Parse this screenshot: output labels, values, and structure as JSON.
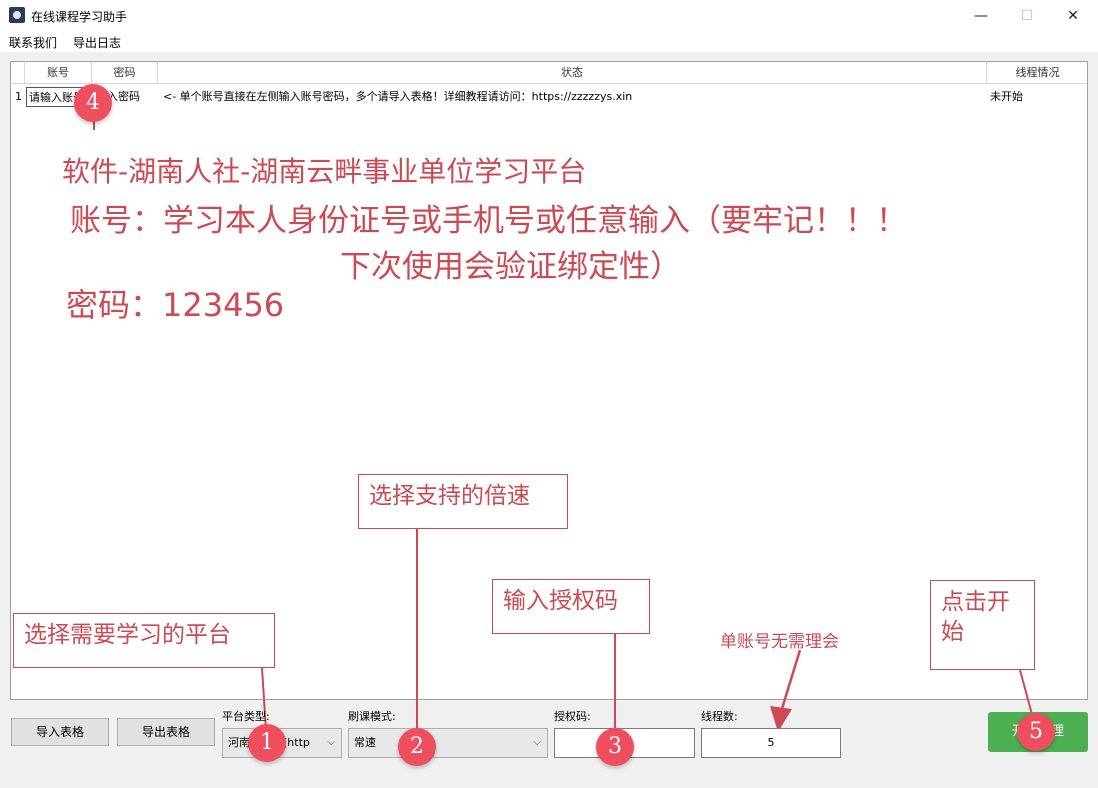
{
  "window": {
    "title": "在线课程学习助手",
    "min_symbol": "—",
    "max_symbol": "☐",
    "close_symbol": "✕"
  },
  "menu": {
    "items": [
      "联系我们",
      "导出日志"
    ]
  },
  "table": {
    "headers": [
      "账号",
      "密码",
      "状态",
      "线程情况"
    ],
    "rows": [
      {
        "index": "1",
        "account": "请输入账号",
        "password": "输入密码",
        "status": "<- 单个账号直接在左侧输入账号密码，多个请导入表格！详细教程请访问：https://zzzzzys.xin",
        "thread": "未开始"
      }
    ]
  },
  "overlay": {
    "line1": "软件-湖南人社-湖南云畔事业单位学习平台",
    "line2": "账号：学习本人身份证号或手机号或任意输入（要牢记！！！",
    "line3": "下次使用会验证绑定性）",
    "line4": "密码：123456"
  },
  "callouts": {
    "platform": "选择需要学习的平台",
    "speed": "选择支持的倍速",
    "auth": "输入授权码",
    "start": "点击开始",
    "single_note": "单账号无需理会"
  },
  "markers": [
    "1",
    "2",
    "3",
    "4",
    "5"
  ],
  "controls": {
    "import_button": "导入表格",
    "export_button": "导出表格",
    "platform_label": "平台类型:",
    "platform_value": "河南……线(http",
    "mode_label": "刷课模式:",
    "mode_value": "常速",
    "auth_label": "授权码:",
    "auth_value": "",
    "threads_label": "线程数:",
    "threads_value": "5",
    "start_button": "开始处理"
  },
  "colors": {
    "annotation": "#cd4a55",
    "marker": "#ee4e5e",
    "start_button": "#4caf50"
  }
}
